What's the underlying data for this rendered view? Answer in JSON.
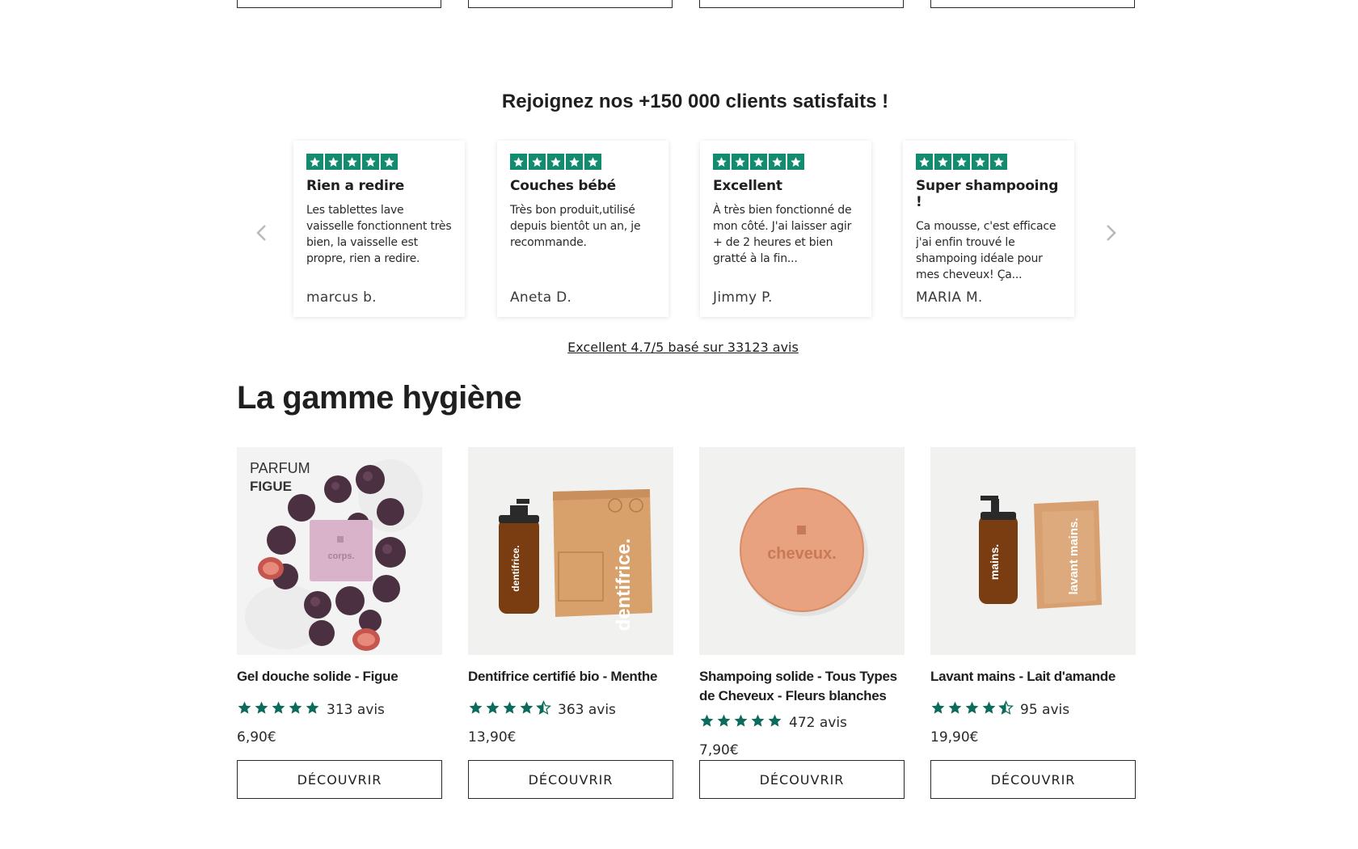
{
  "headline": "Rejoignez nos +150 000 clients satisfaits !",
  "colors": {
    "trust_green": "#138b6e",
    "rating_teal": "#0d6b5b",
    "text": "#1f1f1f"
  },
  "carousel": {
    "prev_icon": "chevron-left-icon",
    "next_icon": "chevron-right-icon",
    "reviews": [
      {
        "rating": 5,
        "title": "Rien a redire",
        "body": "Les tablettes lave vaisselle fonctionnent très bien, la vaisselle est propre, rien a redire.",
        "author": "marcus b."
      },
      {
        "rating": 5,
        "title": "Couches bébé",
        "body": "Très bon produit,utilisé depuis bientôt un an, je recommande.",
        "author": "Aneta D."
      },
      {
        "rating": 5,
        "title": "Excellent",
        "body": "À très bien fonctionné de mon côté. J'ai laisser agir + de 2 heures et bien gratté à la fin...",
        "author": "Jimmy P."
      },
      {
        "rating": 5,
        "title": "Super shampooing !",
        "body": "Ca mousse, c'est efficace j'ai enfin trouvé le shampoing idéale pour mes cheveux! Ça...",
        "author": "MARIA M."
      }
    ]
  },
  "summary_link": "Excellent 4.7/5 basé sur 33123 avis",
  "section_title": "La gamme hygiène",
  "products": [
    {
      "name": "Gel douche solide - Figue",
      "rating": 5,
      "reviews": "313 avis",
      "price": "6,90€",
      "button": "DÉCOUVRIR",
      "image_label_top": "PARFUM",
      "image_label_bottom": "FIGUE",
      "product_mark": "corps."
    },
    {
      "name": "Dentifrice certifié bio - Menthe",
      "rating": 4.5,
      "reviews": "363 avis",
      "price": "13,90€",
      "button": "DÉCOUVRIR",
      "product_mark": "dentifrice."
    },
    {
      "name": "Shampoing solide - Tous Types de Cheveux - Fleurs blanches",
      "rating": 5,
      "reviews": "472 avis",
      "price": "7,90€",
      "button": "DÉCOUVRIR",
      "product_mark": "cheveux."
    },
    {
      "name": "Lavant mains - Lait d'amande",
      "rating": 4.5,
      "reviews": "95 avis",
      "price": "19,90€",
      "button": "DÉCOUVRIR",
      "product_mark": "mains.",
      "product_mark_2": "lavant mains."
    }
  ]
}
